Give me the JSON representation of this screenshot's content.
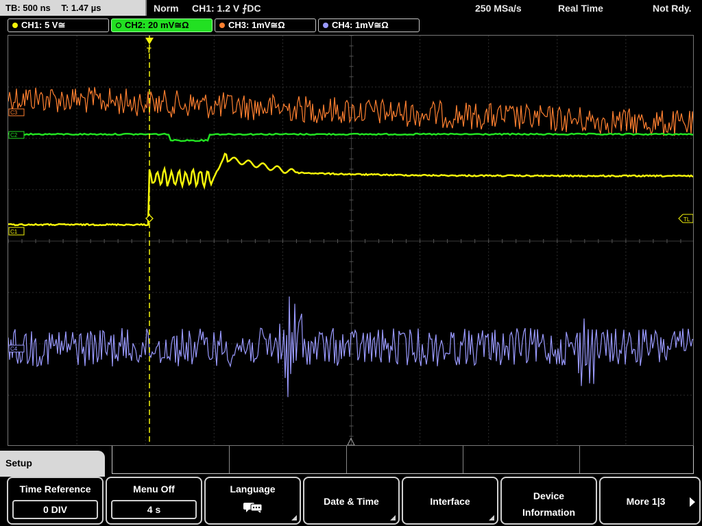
{
  "status": {
    "timebase": "TB: 500 ns",
    "trigger_time": "T: 1.47 µs",
    "mode": "Norm",
    "trigger": "CH1: 1.2 V ⨍DC",
    "sample_rate": "250 MSa/s",
    "acq_mode": "Real Time",
    "ready": "Not Rdy."
  },
  "channels": [
    {
      "label": "CH1: 5 V≅",
      "color": "#f5f50a"
    },
    {
      "label": "CH2: 20 mV≅Ω",
      "color": "#22e022"
    },
    {
      "label": "CH3: 1mV≅Ω",
      "color": "#ff8030"
    },
    {
      "label": "CH4: 1mV≅Ω",
      "color": "#9a9aff"
    }
  ],
  "markers": {
    "c3": "C3",
    "c2": "C2",
    "c1": "C1",
    "c4": "C4",
    "tl": "TL",
    "trigger_t": "T"
  },
  "setup_tab": "Setup",
  "softkeys": {
    "time_reference": {
      "label": "Time Reference",
      "value": "0 DIV"
    },
    "menu_off": {
      "label": "Menu Off",
      "value": "4 s"
    },
    "language": {
      "label": "Language",
      "icon": "speech-bubbles-icon"
    },
    "date_time": {
      "label": "Date & Time"
    },
    "interface": {
      "label": "Interface"
    },
    "device_info": {
      "line1": "Device",
      "line2": "Information"
    },
    "more": {
      "label": "More 1|3"
    }
  }
}
